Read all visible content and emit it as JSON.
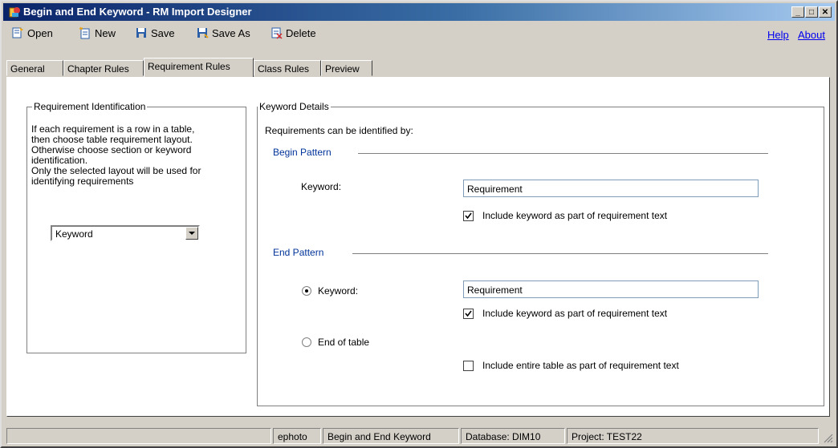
{
  "window": {
    "title": "Begin and End Keyword - RM Import Designer",
    "icon": "app-icon"
  },
  "titlebar_buttons": {
    "minimize": "_",
    "maximize": "□",
    "close": "✕"
  },
  "toolbar": {
    "open": {
      "label": "Open",
      "icon": "open-icon"
    },
    "new": {
      "label": "New",
      "icon": "new-icon"
    },
    "save": {
      "label": "Save",
      "icon": "save-icon"
    },
    "save_as": {
      "label": "Save As",
      "icon": "save-as-icon"
    },
    "delete": {
      "label": "Delete",
      "icon": "delete-icon"
    },
    "help": "Help",
    "about": "About"
  },
  "tabs": [
    {
      "label": "General",
      "active": false
    },
    {
      "label": "Chapter Rules",
      "active": false
    },
    {
      "label": "Requirement Rules",
      "active": true
    },
    {
      "label": "Class Rules",
      "active": false
    },
    {
      "label": "Preview",
      "active": false
    }
  ],
  "left_group": {
    "title": "Requirement Identification",
    "description": [
      "If each requirement is a row in a table,",
      "then choose table requirement layout.",
      "Otherwise choose section or keyword",
      "identification.",
      "Only the selected layout will be used for",
      "identifying requirements"
    ],
    "layout_select": "Keyword"
  },
  "right_group": {
    "title": "Keyword Details",
    "intro": "Requirements can be identified by:",
    "begin": {
      "heading": "Begin Pattern",
      "keyword_label": "Keyword:",
      "keyword_value": "Requirement",
      "include_label": "Include keyword as part of requirement text",
      "include_checked": true
    },
    "end": {
      "heading": "End Pattern",
      "keyword_label": "Keyword:",
      "keyword_selected": true,
      "keyword_value": "Requirement",
      "include_label": "Include keyword as part of requirement text",
      "include_checked": true,
      "end_of_table_label": "End of table",
      "end_of_table_selected": false,
      "include_table_label": "Include entire table as part of requirement text",
      "include_table_checked": false
    }
  },
  "status": {
    "user": "ephoto",
    "rule": "Begin and End Keyword",
    "database": "Database: DIM10",
    "project": "Project: TEST22"
  }
}
